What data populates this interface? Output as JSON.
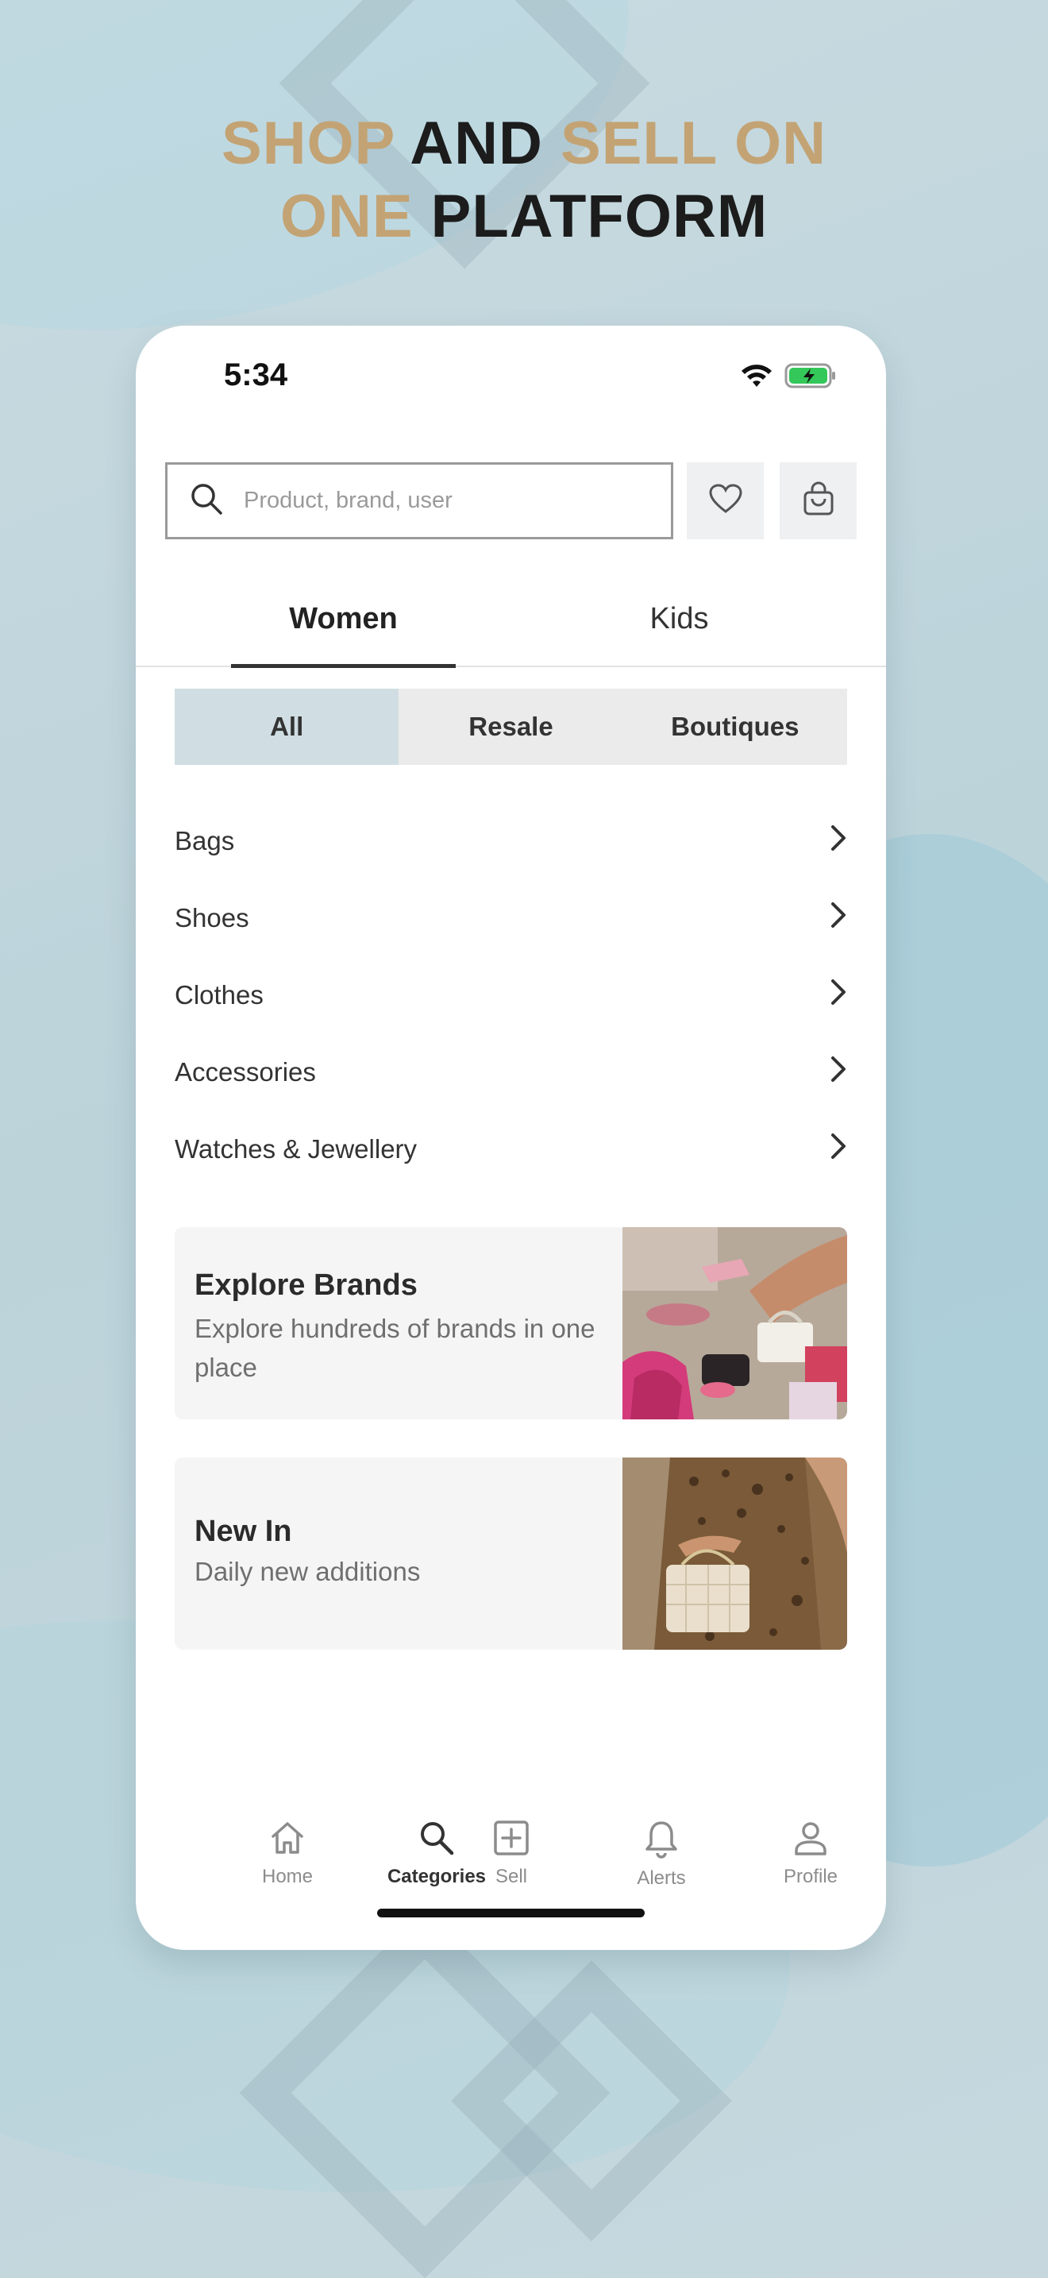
{
  "headline": {
    "line1": [
      {
        "text": "SHOP ",
        "color": "gold"
      },
      {
        "text": "AND ",
        "color": "dark"
      },
      {
        "text": "SELL ON",
        "color": "gold"
      }
    ],
    "line2": [
      {
        "text": "ONE ",
        "color": "gold"
      },
      {
        "text": "PLATFORM",
        "color": "dark"
      }
    ]
  },
  "colors": {
    "gold": "#c3a374",
    "dark": "#1c1c1c",
    "segment_active": "#d0dee3",
    "battery": "#34c759"
  },
  "status_bar": {
    "time": "5:34",
    "icons": [
      "wifi-icon",
      "battery-charging-icon"
    ]
  },
  "search": {
    "placeholder": "Product, brand, user",
    "icon": "search-icon"
  },
  "header_actions": [
    "heart-icon",
    "shopping-bag-icon"
  ],
  "tabs": [
    {
      "label": "Women",
      "active": true
    },
    {
      "label": "Kids",
      "active": false
    }
  ],
  "segments": [
    {
      "label": "All",
      "active": true
    },
    {
      "label": "Resale",
      "active": false
    },
    {
      "label": "Boutiques",
      "active": false
    }
  ],
  "categories": [
    {
      "label": "Bags"
    },
    {
      "label": "Shoes"
    },
    {
      "label": "Clothes"
    },
    {
      "label": "Accessories"
    },
    {
      "label": "Watches & Jewellery"
    }
  ],
  "promos": [
    {
      "title": "Explore Brands",
      "subtitle": "Explore hundreds of brands in one place",
      "image": "handbags-and-shoes-photo"
    },
    {
      "title": "New In",
      "subtitle": "Daily new additions",
      "image": "woman-with-quilted-bag-photo"
    }
  ],
  "tab_bar": [
    {
      "label": "Home",
      "icon": "home-icon",
      "active": false
    },
    {
      "label": "Categories",
      "icon": "search-icon",
      "active": true
    },
    {
      "label": "Sell",
      "icon": "plus-square-icon",
      "active": false
    },
    {
      "label": "Alerts",
      "icon": "bell-icon",
      "active": false
    },
    {
      "label": "Profile",
      "icon": "person-icon",
      "active": false
    }
  ]
}
